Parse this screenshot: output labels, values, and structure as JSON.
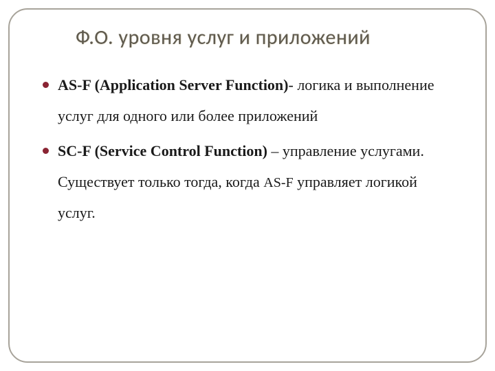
{
  "title": "Ф.О. уровня услуг и приложений",
  "items": [
    {
      "term": "AS-F (Application Server Function)",
      "sep": "- ",
      "desc": "логика  и выполнение услуг для одного или более приложений"
    },
    {
      "term": "SC-F (Service Control Function)",
      "sep": " – ",
      "desc_a": "управление услугами. Существует только тогда, когда ",
      "desc_term": "AS-F",
      "desc_b": " управляет логикой услуг."
    }
  ]
}
